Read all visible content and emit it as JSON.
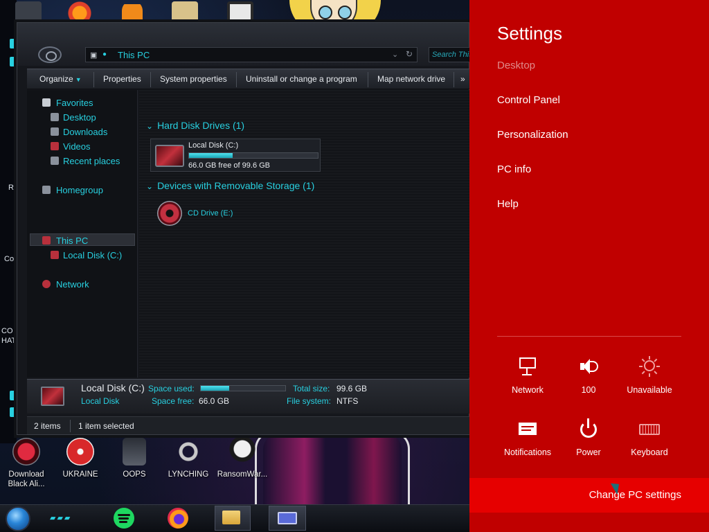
{
  "explorer": {
    "address": "This PC",
    "search_placeholder": "Search This PC",
    "toolbar": {
      "organize": "Organize",
      "properties": "Properties",
      "system_properties": "System properties",
      "uninstall": "Uninstall or change a program",
      "map_drive": "Map network drive",
      "more": "»"
    },
    "nav": {
      "favorites": "Favorites",
      "desktop": "Desktop",
      "downloads": "Downloads",
      "videos": "Videos",
      "recent": "Recent places",
      "homegroup": "Homegroup",
      "this_pc": "This PC",
      "local_disk": "Local Disk (C:)",
      "network": "Network"
    },
    "content": {
      "hdd_header": "Hard Disk Drives (1)",
      "removable_header": "Devices with Removable Storage (1)",
      "drive_name": "Local Disk (C:)",
      "drive_free": "66.0 GB free of 99.6 GB",
      "drive_used_fraction": 0.34,
      "cd_name": "CD Drive (E:)"
    },
    "details": {
      "name": "Local Disk (C:)",
      "type": "Local Disk",
      "space_used_label": "Space used:",
      "space_free_label": "Space free:",
      "space_free_value": "66.0 GB",
      "total_size_label": "Total size:",
      "total_size_value": "99.6 GB",
      "file_system_label": "File system:",
      "file_system_value": "NTFS"
    },
    "status": {
      "items": "2 items",
      "selected": "1 item selected"
    }
  },
  "desktop": {
    "edge_labels": [
      "Re",
      "Co",
      "CO",
      "HAT"
    ],
    "icons": [
      {
        "label": "Download Black Ali...",
        "color": "#b01020"
      },
      {
        "label": "UKRAINE",
        "color": "#d8282a"
      },
      {
        "label": "OOPS",
        "color": "#5a5f6a"
      },
      {
        "label": "LYNCHING",
        "color": "#c8c8c8"
      },
      {
        "label": "RansomWar...",
        "color": "#1a1a1a"
      }
    ]
  },
  "charm": {
    "title": "Settings",
    "context": "Desktop",
    "links": [
      "Control Panel",
      "Personalization",
      "PC info",
      "Help"
    ],
    "quick": [
      {
        "label": "Network",
        "icon": "network-icon"
      },
      {
        "label": "100",
        "icon": "volume-icon"
      },
      {
        "label": "Unavailable",
        "icon": "brightness-icon"
      },
      {
        "label": "Notifications",
        "icon": "notifications-icon"
      },
      {
        "label": "Power",
        "icon": "power-icon"
      },
      {
        "label": "Keyboard",
        "icon": "keyboard-icon"
      }
    ],
    "change_pc_settings": "Change PC settings",
    "colors": {
      "background": "#c00000",
      "accent": "#e60000"
    }
  }
}
